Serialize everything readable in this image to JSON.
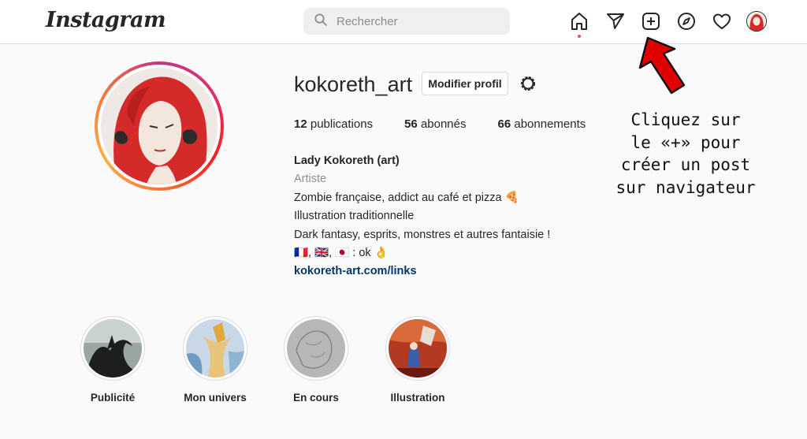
{
  "topbar": {
    "logo": "Instagram",
    "search_placeholder": "Rechercher",
    "icons": [
      "home-icon",
      "send-icon",
      "new-post-icon",
      "explore-icon",
      "heart-icon",
      "avatar"
    ]
  },
  "profile": {
    "username": "kokoreth_art",
    "edit_label": "Modifier profil",
    "stats": {
      "publications_count": "12",
      "publications_label": "publications",
      "abonnes_count": "56",
      "abonnes_label": "abonnés",
      "abonnements_count": "66",
      "abonnements_label": "abonnements"
    },
    "bio": {
      "name": "Lady Kokoreth (art)",
      "category": "Artiste",
      "line1": "Zombie française, addict au café et pizza 🍕",
      "line2": "Illustration traditionnelle",
      "line3": "Dark fantasy, esprits, monstres et autres fantaisie !",
      "line4": "🇫🇷, 🇬🇧, 🇯🇵 : ok 👌",
      "link": "kokoreth-art.com/links"
    }
  },
  "annotation": {
    "line1": "Cliquez sur",
    "line2": "le «+» pour",
    "line3": "créer un post",
    "line4": "sur navigateur",
    "arrow_color": "#e00000"
  },
  "highlights": [
    {
      "label": "Publicité"
    },
    {
      "label": "Mon univers"
    },
    {
      "label": "En cours"
    },
    {
      "label": "Illustration"
    }
  ],
  "colors": {
    "link": "#00376b",
    "notification_dot": "#ed4956"
  }
}
